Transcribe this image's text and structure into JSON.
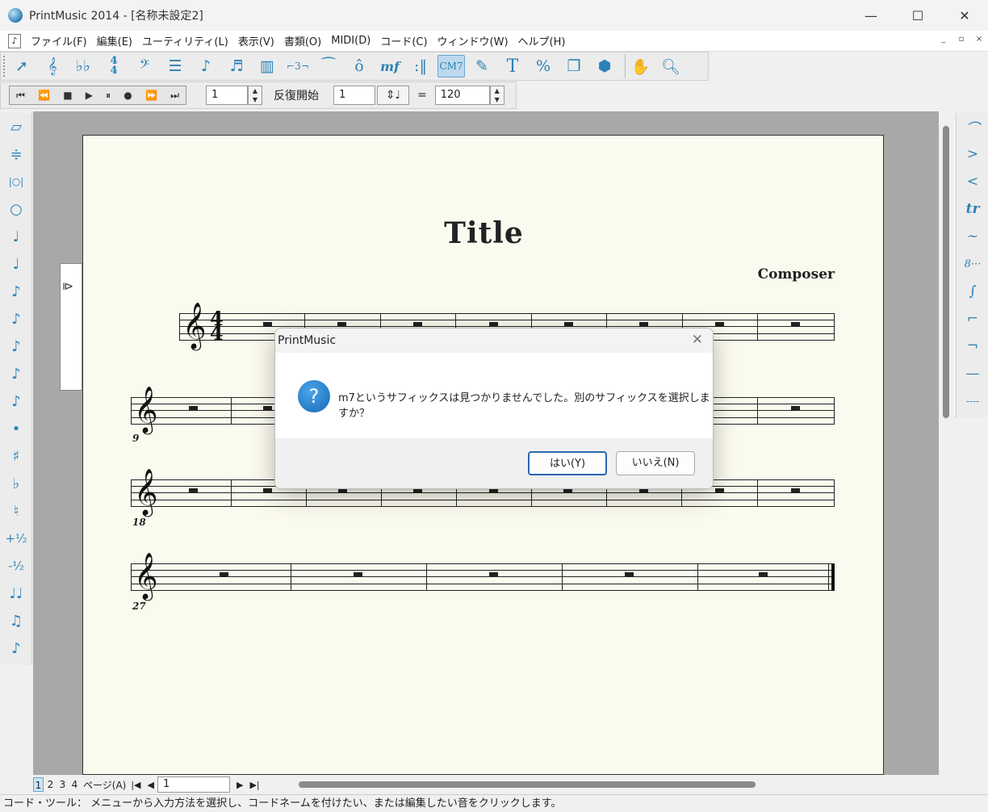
{
  "window": {
    "title": "PrintMusic 2014 - [名称未設定2]",
    "minimize": "—",
    "maximize": "☐",
    "close": "✕"
  },
  "menu": {
    "items": [
      "ファイル(F)",
      "編集(E)",
      "ユーティリティ(L)",
      "表示(V)",
      "書類(O)",
      "MIDI(D)",
      "コード(C)",
      "ウィンドウ(W)",
      "ヘルプ(H)"
    ],
    "mdi": [
      "_",
      "▫",
      "×"
    ]
  },
  "toolbar": {
    "icons": [
      "arrow-icon",
      "treble-clef-icon",
      "key-signature-icon",
      "time-signature-icon",
      "bass-clef-icon",
      "staff-icon",
      "note-icon",
      "grace-note-icon",
      "keyboard-icon",
      "tuplet-icon",
      "slur-icon",
      "articulation-icon",
      "expression-icon",
      "repeat-icon",
      "chord-icon",
      "lyrics-icon",
      "text-icon",
      "percent-icon",
      "page-icon",
      "mirror-icon",
      "hand-icon",
      "zoom-icon"
    ],
    "labels": {
      "tuplet": "⌐3¬",
      "expression": "mf",
      "chord": "CM7",
      "text": "T",
      "percent": "%"
    }
  },
  "playback": {
    "measure": "1",
    "repeat_label": "反復開始",
    "repeat_value": "1",
    "equals": "=",
    "tempo": "120",
    "buttons": [
      "⏮",
      "⏪",
      "■",
      "▶",
      "⏸",
      "●",
      "⏩",
      "⏭"
    ]
  },
  "left_palette": [
    "eraser-icon",
    "stem-icon",
    "whole-double-icon",
    "whole-icon",
    "half-icon",
    "quarter-icon",
    "eighth-icon",
    "sixteenth-icon",
    "32nd-icon",
    "64th-icon",
    "128th-icon",
    "dot-icon",
    "sharp-icon",
    "flat-icon",
    "natural-icon",
    "half-step-up-icon",
    "half-step-down-icon",
    "tie-icon",
    "tuplet-icon",
    "grace-icon"
  ],
  "left_palette_labels": [
    "▱",
    "≑",
    "|○|",
    "○",
    "♩",
    "♩",
    "♪",
    "♪",
    "♪",
    "♪",
    "♪",
    "•",
    "♯",
    "♭",
    "♮",
    "+½",
    "-½",
    "♩♩",
    "♫",
    "♪"
  ],
  "right_palette_labels": [
    "⌒",
    ">",
    "<",
    "tr",
    "~",
    "8···",
    "∫",
    "⌐",
    "¬",
    "—",
    "----"
  ],
  "score": {
    "title": "Title",
    "composer": "Composer",
    "measure_numbers": [
      "9",
      "18",
      "27"
    ],
    "time_sig_top": "4",
    "time_sig_bottom": "4",
    "clef": "𝄞"
  },
  "dialog": {
    "title": "PrintMusic",
    "message": "m7というサフィックスは見つかりませんでした。別のサフィックスを選択しますか？",
    "yes": "はい(Y)",
    "no": "いいえ(N)",
    "close": "✕",
    "icon": "?"
  },
  "pages": [
    "1",
    "2",
    "3",
    "4"
  ],
  "page_label": "ページ(A)",
  "page_input": "1",
  "status": "コード・ツール： メニューから入力方法を選択し、コードネームを付けたい、または編集したい音をクリックします。"
}
